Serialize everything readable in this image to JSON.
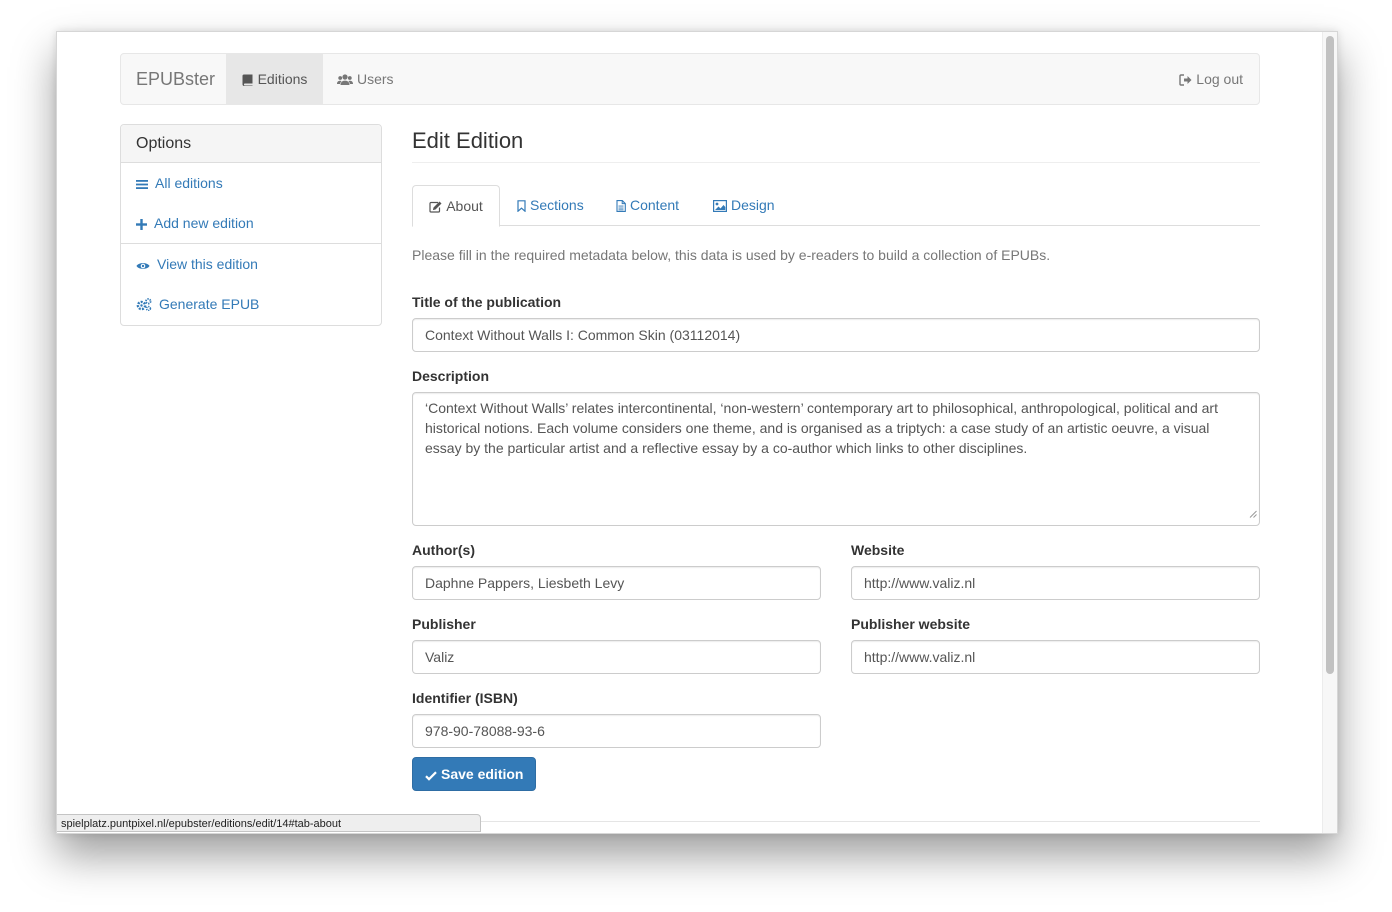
{
  "navbar": {
    "brand": "EPUBster",
    "items": [
      {
        "label": "Editions",
        "icon": "book-icon",
        "active": true
      },
      {
        "label": "Users",
        "icon": "users-icon",
        "active": false
      }
    ],
    "logout": {
      "label": "Log out",
      "icon": "sign-out-icon"
    }
  },
  "sidebar": {
    "title": "Options",
    "items": [
      {
        "label": "All editions",
        "icon": "list-icon"
      },
      {
        "label": "Add new edition",
        "icon": "plus-icon"
      },
      {
        "label": "View this edition",
        "icon": "eye-icon"
      },
      {
        "label": "Generate EPUB",
        "icon": "cogs-icon"
      }
    ]
  },
  "main": {
    "title": "Edit Edition",
    "tabs": [
      {
        "label": "About",
        "icon": "edit-icon",
        "active": true
      },
      {
        "label": "Sections",
        "icon": "bookmark-icon",
        "active": false
      },
      {
        "label": "Content",
        "icon": "file-icon",
        "active": false
      },
      {
        "label": "Design",
        "icon": "picture-icon",
        "active": false
      }
    ],
    "help": "Please fill in the required metadata below, this data is used by e-readers to build a collection of EPUBs.",
    "form": {
      "title": {
        "label": "Title of the publication",
        "value": "Context Without Walls I: Common Skin (03112014)"
      },
      "description": {
        "label": "Description",
        "value": "‘Context Without Walls’ relates intercontinental, ‘non-western’ contemporary art to philosophical, anthropological, political and art historical notions. Each volume considers one theme, and is organised as a triptych: a case study of an artistic oeuvre, a visual essay by the particular artist and a reflective essay by a co-author which links to other disciplines."
      },
      "authors": {
        "label": "Author(s)",
        "value": "Daphne Pappers, Liesbeth Levy"
      },
      "website": {
        "label": "Website",
        "value": "http://www.valiz.nl"
      },
      "publisher": {
        "label": "Publisher",
        "value": "Valiz"
      },
      "publisher_website": {
        "label": "Publisher website",
        "value": "http://www.valiz.nl"
      },
      "isbn": {
        "label": "Identifier (ISBN)",
        "value": "978-90-78088-93-6"
      }
    },
    "save_label": "Save edition"
  },
  "statusbar": {
    "url": "spielplatz.puntpixel.nl/epubster/editions/edit/14#tab-about"
  },
  "colors": {
    "link": "#337ab7",
    "primary": "#337ab7",
    "navbar_bg": "#f8f8f8",
    "active_nav_bg": "#e7e7e7"
  }
}
